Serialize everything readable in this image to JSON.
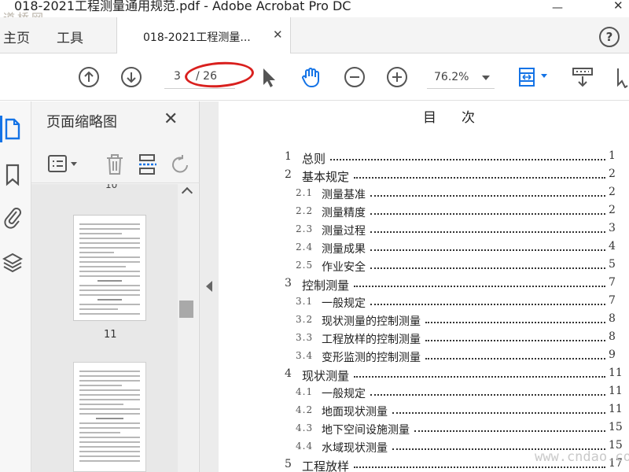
{
  "window": {
    "title": "018-2021工程测量通用规范.pdf - Adobe Acrobat Pro DC",
    "logo_text": "道桥网",
    "minimize": "—",
    "close": "✕"
  },
  "tabs": {
    "home": "主页",
    "tools": "工具",
    "document": "018-2021工程测量...",
    "document_close": "✕",
    "help": "?"
  },
  "toolbar": {
    "current_page": "3",
    "total_pages": "/ 26",
    "zoom": "76.2%",
    "icons": [
      "prev-page-icon",
      "next-page-icon",
      "select-icon",
      "hand-icon",
      "zoom-out-icon",
      "zoom-in-icon",
      "fit-page-icon",
      "read-mode-icon",
      "more-icon"
    ]
  },
  "sidebar": {
    "icons": [
      "pages-icon",
      "bookmark-icon",
      "attachment-icon",
      "layers-icon"
    ]
  },
  "thumbnails": {
    "title": "页面缩略图",
    "close": "✕",
    "partial_label": "10",
    "page_label": "11"
  },
  "document": {
    "heading": "目次",
    "toc": [
      {
        "level": 1,
        "no": "1",
        "title": "总则",
        "page": "1"
      },
      {
        "level": 1,
        "no": "2",
        "title": "基本规定",
        "page": "2"
      },
      {
        "level": 2,
        "no": "2.1",
        "title": "测量基准",
        "page": "2"
      },
      {
        "level": 2,
        "no": "2.2",
        "title": "测量精度",
        "page": "2"
      },
      {
        "level": 2,
        "no": "2.3",
        "title": "测量过程",
        "page": "3"
      },
      {
        "level": 2,
        "no": "2.4",
        "title": "测量成果",
        "page": "4"
      },
      {
        "level": 2,
        "no": "2.5",
        "title": "作业安全",
        "page": "5"
      },
      {
        "level": 1,
        "no": "3",
        "title": "控制测量",
        "page": "7"
      },
      {
        "level": 2,
        "no": "3.1",
        "title": "一般规定",
        "page": "7"
      },
      {
        "level": 2,
        "no": "3.2",
        "title": "现状测量的控制测量",
        "page": "8"
      },
      {
        "level": 2,
        "no": "3.3",
        "title": "工程放样的控制测量",
        "page": "8"
      },
      {
        "level": 2,
        "no": "3.4",
        "title": "变形监测的控制测量",
        "page": "9"
      },
      {
        "level": 1,
        "no": "4",
        "title": "现状测量",
        "page": "11"
      },
      {
        "level": 2,
        "no": "4.1",
        "title": "一般规定",
        "page": "11"
      },
      {
        "level": 2,
        "no": "4.2",
        "title": "地面现状测量",
        "page": "11"
      },
      {
        "level": 2,
        "no": "4.3",
        "title": "地下空间设施测量",
        "page": "15"
      },
      {
        "level": 2,
        "no": "4.4",
        "title": "水域现状测量",
        "page": "15"
      },
      {
        "level": 1,
        "no": "5",
        "title": "工程放样",
        "page": "17"
      }
    ],
    "watermark": "www.cndao.com"
  },
  "colors": {
    "accent": "#1473e6",
    "annotation": "#d9201e"
  }
}
